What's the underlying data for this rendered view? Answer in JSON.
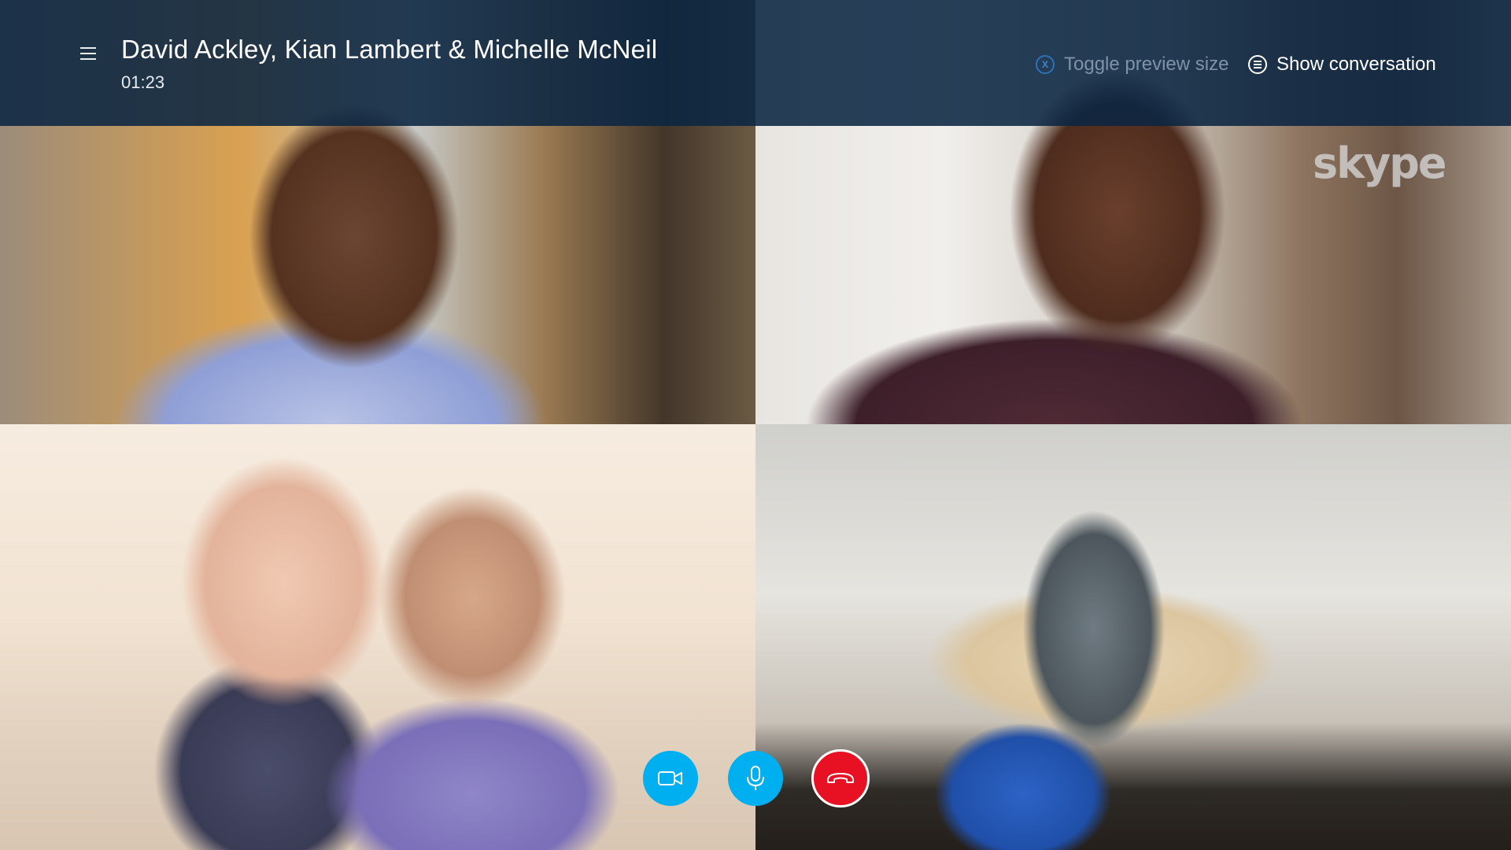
{
  "header": {
    "menu_icon": "hamburger-menu-icon",
    "title": "David Ackley, Kian Lambert & Michelle McNeil",
    "timer": "01:23"
  },
  "actions": {
    "toggle_preview": {
      "label": "Toggle preview size",
      "icon": "x-button-icon",
      "icon_glyph": "X"
    },
    "show_conversation": {
      "label": "Show conversation",
      "icon": "conversation-icon"
    }
  },
  "watermark": {
    "text": "skype"
  },
  "participants": [
    {
      "name": "David Ackley"
    },
    {
      "name": "Kian Lambert"
    },
    {
      "name": "Michelle McNeil"
    },
    {
      "name": ""
    }
  ],
  "controls": {
    "video": {
      "icon": "video-camera-icon",
      "color": "#00aff0"
    },
    "mic": {
      "icon": "microphone-icon",
      "color": "#00aff0"
    },
    "end_call": {
      "icon": "hang-up-icon",
      "color": "#e81123"
    }
  },
  "colors": {
    "topbar": "#0a2642",
    "accent": "#00aff0",
    "danger": "#e81123"
  }
}
